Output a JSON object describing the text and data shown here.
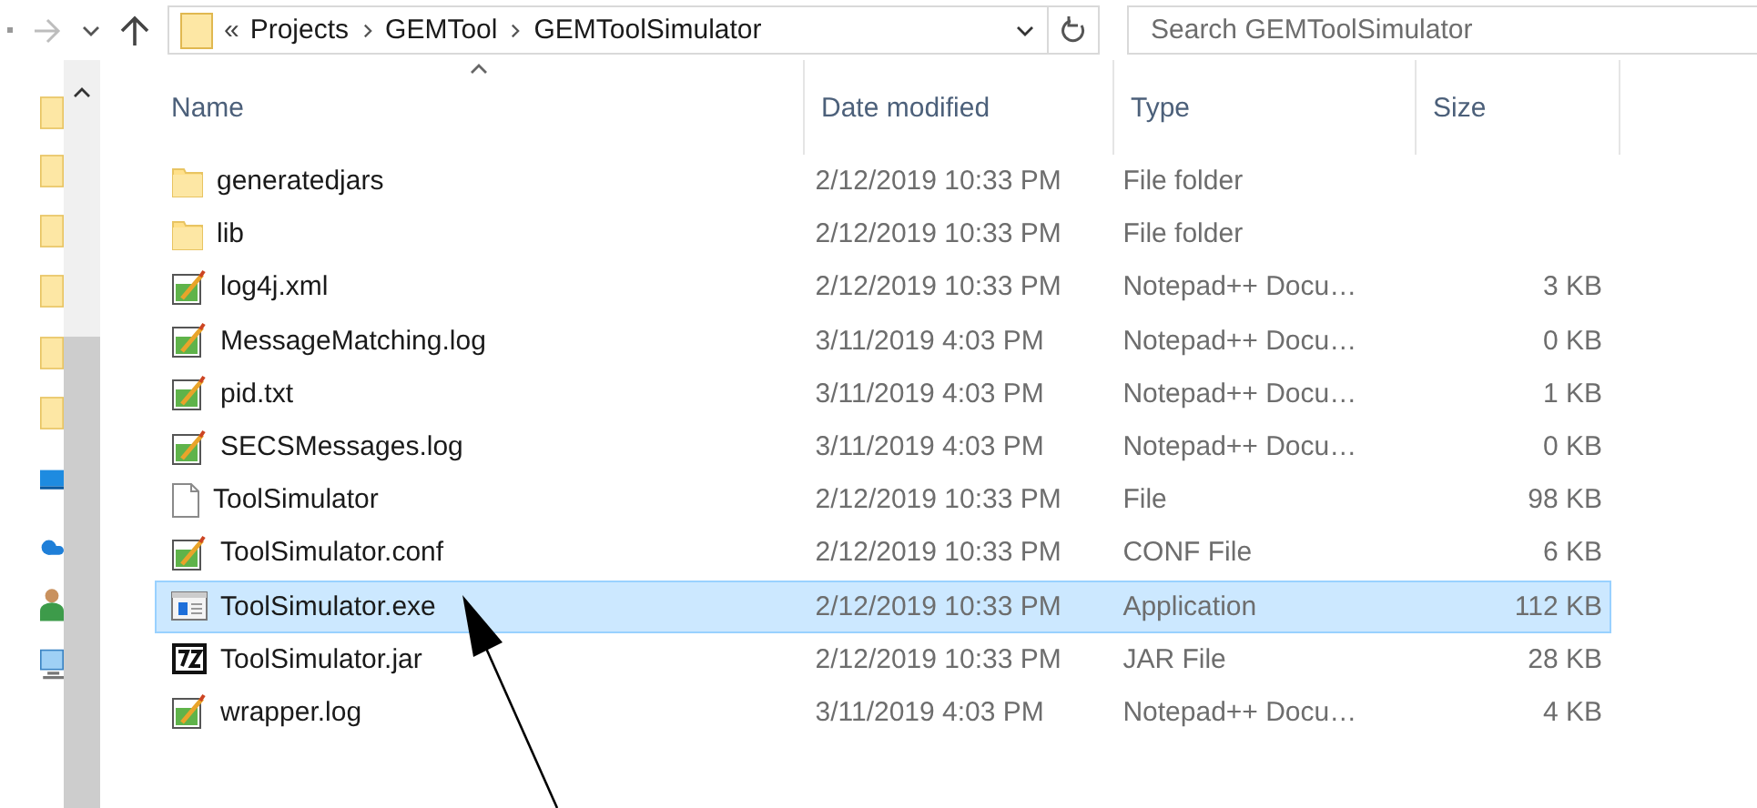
{
  "toolbar": {
    "breadcrumbs": [
      "Projects",
      "GEMTool",
      "GEMToolSimulator"
    ],
    "overflow": "«",
    "search": {
      "placeholder": "Search GEMToolSimulator"
    }
  },
  "columns": [
    {
      "label": "Name",
      "sorted": true
    },
    {
      "label": "Date modified",
      "sorted": false
    },
    {
      "label": "Type",
      "sorted": false
    },
    {
      "label": "Size",
      "sorted": false
    }
  ],
  "files": [
    {
      "name": "generatedjars",
      "date": "2/12/2019 10:33 PM",
      "type": "File folder",
      "kind": "folder",
      "selected": false
    },
    {
      "name": "lib",
      "date": "2/12/2019 10:33 PM",
      "type": "File folder",
      "kind": "folder",
      "selected": false
    },
    {
      "name": "log4j.xml",
      "date": "2/12/2019 10:33 PM",
      "type": "Notepad++ Docu…",
      "size": "3 KB",
      "kind": "notepad",
      "selected": false
    },
    {
      "name": "MessageMatching.log",
      "date": "3/11/2019 4:03 PM",
      "type": "Notepad++ Docu…",
      "size": "0 KB",
      "kind": "notepad",
      "selected": false
    },
    {
      "name": "pid.txt",
      "date": "3/11/2019 4:03 PM",
      "type": "Notepad++ Docu…",
      "size": "1 KB",
      "kind": "notepad",
      "selected": false
    },
    {
      "name": "SECSMessages.log",
      "date": "3/11/2019 4:03 PM",
      "type": "Notepad++ Docu…",
      "size": "0 KB",
      "kind": "notepad",
      "selected": false
    },
    {
      "name": "ToolSimulator",
      "date": "2/12/2019 10:33 PM",
      "type": "File",
      "size": "98 KB",
      "kind": "file",
      "selected": false
    },
    {
      "name": "ToolSimulator.conf",
      "date": "2/12/2019 10:33 PM",
      "type": "CONF File",
      "size": "6 KB",
      "kind": "notepad",
      "selected": false
    },
    {
      "name": "ToolSimulator.exe",
      "date": "2/12/2019 10:33 PM",
      "type": "Application",
      "size": "112 KB",
      "kind": "exe",
      "selected": true
    },
    {
      "name": "ToolSimulator.jar",
      "date": "2/12/2019 10:33 PM",
      "type": "JAR File",
      "size": "28 KB",
      "kind": "archive",
      "selected": false
    },
    {
      "name": "wrapper.log",
      "date": "3/11/2019 4:03 PM",
      "type": "Notepad++ Docu…",
      "size": "4 KB",
      "kind": "notepad",
      "selected": false
    }
  ],
  "nav_items": [
    {
      "kind": "folder"
    },
    {
      "kind": "folder"
    },
    {
      "kind": "folder"
    },
    {
      "kind": "folder"
    },
    {
      "kind": "folder"
    },
    {
      "kind": "folder"
    },
    {
      "kind": "desktop"
    },
    {
      "kind": "cloud"
    },
    {
      "kind": "user"
    },
    {
      "kind": "computer"
    }
  ]
}
